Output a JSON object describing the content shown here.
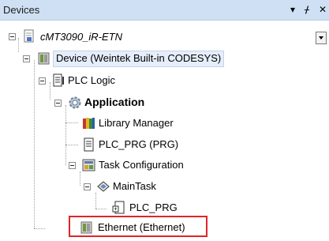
{
  "panel": {
    "title": "Devices",
    "buttons": {
      "dropdown_glyph": "▾",
      "pin_glyph": "ᚋ",
      "close_glyph": "✕"
    }
  },
  "tree": {
    "root": {
      "label": "cMT3090_iR-ETN",
      "icon": "project-file-icon"
    },
    "device": {
      "label": "Device (Weintek Built-in CODESYS)",
      "icon": "plc-device-icon"
    },
    "plc_logic": {
      "label": "PLC Logic",
      "icon": "plc-logic-icon"
    },
    "application": {
      "label": "Application",
      "icon": "application-gear-icon"
    },
    "library_manager": {
      "label": "Library Manager",
      "icon": "library-books-icon"
    },
    "plc_prg": {
      "label": "PLC_PRG (PRG)",
      "icon": "program-document-icon"
    },
    "task_configuration": {
      "label": "Task Configuration",
      "icon": "task-configuration-icon"
    },
    "main_task": {
      "label": "MainTask",
      "icon": "main-task-icon"
    },
    "plc_prg_call": {
      "label": "PLC_PRG",
      "icon": "program-call-icon"
    },
    "ethernet": {
      "label": "Ethernet (Ethernet)",
      "icon": "ethernet-device-icon"
    }
  },
  "colors": {
    "header_bg": "#cfe0f4",
    "selection_bg": "#e5eefa",
    "highlight_border": "#e0242a"
  }
}
